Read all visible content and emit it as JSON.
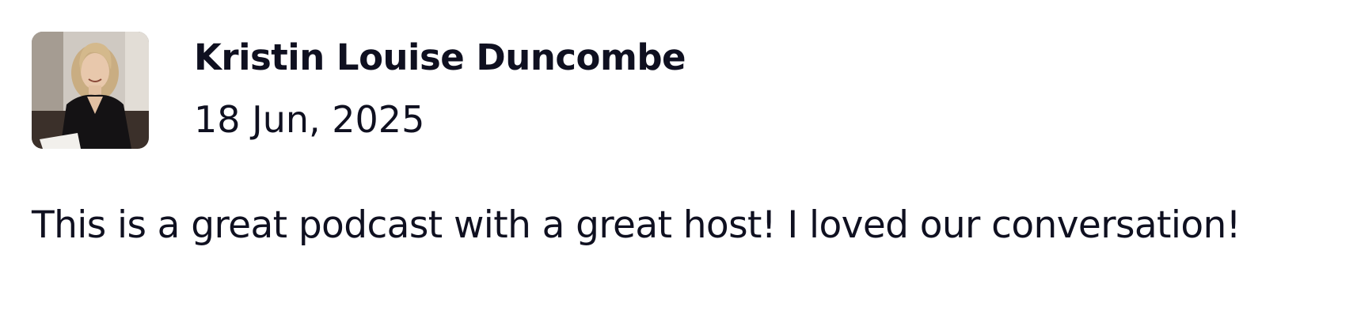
{
  "review": {
    "reviewer_name": "Kristin Louise Duncombe",
    "date": "18 Jun, 2025",
    "text": "This is a great podcast with a great host! I loved our conversation!",
    "avatar_icon": "avatar-photo"
  }
}
